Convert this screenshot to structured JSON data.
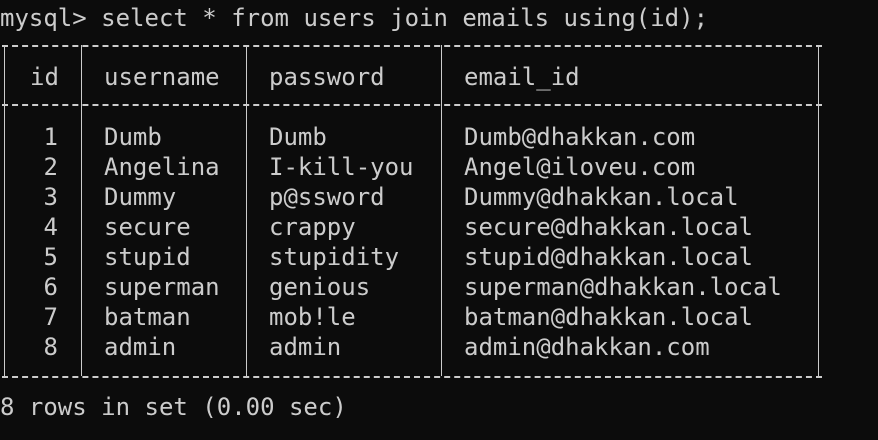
{
  "prompt": "mysql> ",
  "command": "select * from users join emails using(id);",
  "columns": [
    "id",
    "username",
    "password",
    "email_id"
  ],
  "rows": [
    [
      "1",
      "Dumb",
      "Dumb",
      "Dumb@dhakkan.com"
    ],
    [
      "2",
      "Angelina",
      "I-kill-you",
      "Angel@iloveu.com"
    ],
    [
      "3",
      "Dummy",
      "p@ssword",
      "Dummy@dhakkan.local"
    ],
    [
      "4",
      "secure",
      "crappy",
      "secure@dhakkan.local"
    ],
    [
      "5",
      "stupid",
      "stupidity",
      "stupid@dhakkan.local"
    ],
    [
      "6",
      "superman",
      "genious",
      "superman@dhakkan.local"
    ],
    [
      "7",
      "batman",
      "mob!le",
      "batman@dhakkan.local"
    ],
    [
      "8",
      "admin",
      "admin",
      "admin@dhakkan.com"
    ]
  ],
  "result_summary": "8 rows in set (0.00 sec)"
}
